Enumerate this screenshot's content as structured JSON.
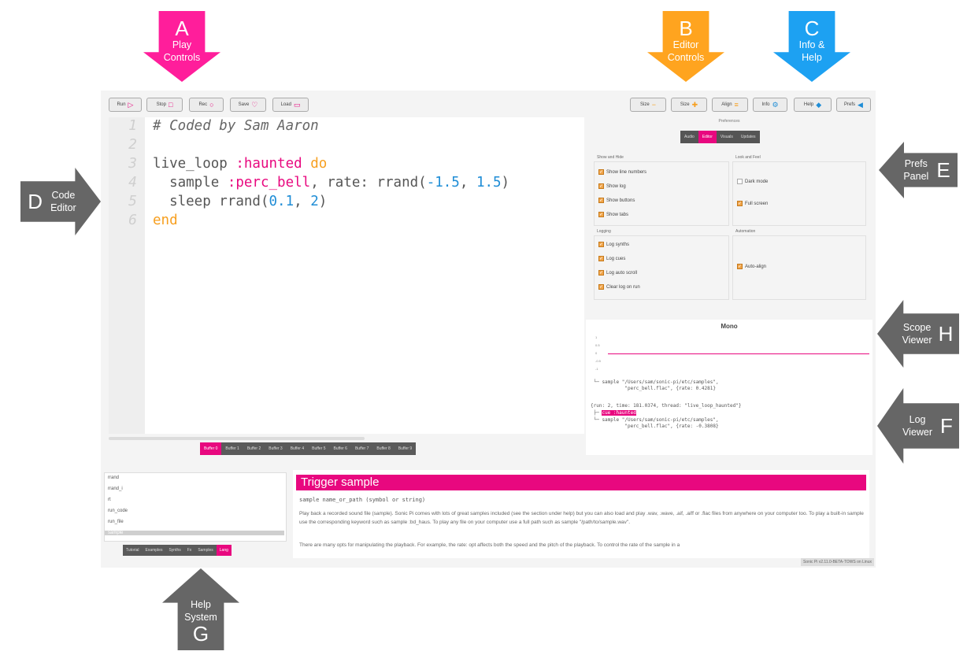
{
  "annotations": {
    "A": {
      "letter": "A",
      "caption": "Play\nControls",
      "color": "#ff1e9b"
    },
    "B": {
      "letter": "B",
      "caption": "Editor\nControls",
      "color": "#ffa41f"
    },
    "C": {
      "letter": "C",
      "caption": "Info &\nHelp",
      "color": "#1da1f2"
    },
    "D": {
      "letter": "D",
      "caption": "Code\nEditor",
      "color": "#666666"
    },
    "E": {
      "letter": "E",
      "caption": "Prefs\nPanel",
      "color": "#666666"
    },
    "F": {
      "letter": "F",
      "caption": "Log\nViewer",
      "color": "#666666"
    },
    "G": {
      "letter": "G",
      "caption": "Help\nSystem",
      "color": "#666666"
    },
    "H": {
      "letter": "H",
      "caption": "Scope\nViewer",
      "color": "#666666"
    }
  },
  "toolbar": {
    "run": "Run",
    "stop": "Stop",
    "rec": "Rec",
    "save": "Save",
    "load": "Load",
    "size_down": "Size",
    "size_up": "Size",
    "align": "Align",
    "info": "Info",
    "help": "Help",
    "prefs": "Prefs"
  },
  "editor": {
    "line_numbers": [
      "1",
      "2",
      "3",
      "4",
      "5",
      "6"
    ],
    "l1": "# Coded by Sam Aaron",
    "l3a": "live_loop ",
    "l3b": ":haunted",
    "l3c": " do",
    "l4a": "  sample ",
    "l4b": ":perc_bell",
    "l4c": ", rate: rrand(",
    "l4d": "-1.5",
    "l4e": ", ",
    "l4f": "1.5",
    "l4g": ")",
    "l5a": "  sleep rrand(",
    "l5b": "0.1",
    "l5c": ", ",
    "l5d": "2",
    "l5e": ")",
    "l6": "end"
  },
  "buffers": [
    "Buffer 0",
    "Buffer 1",
    "Buffer 2",
    "Buffer 3",
    "Buffer 4",
    "Buffer 5",
    "Buffer 6",
    "Buffer 7",
    "Buffer 8",
    "Buffer 9"
  ],
  "prefs": {
    "header": "Preferences",
    "tabs": [
      "Audio",
      "Editor",
      "Visuals",
      "Updates"
    ],
    "group_show_hide": "Show and Hide",
    "show_line_numbers": "Show line numbers",
    "show_log": "Show log",
    "show_buttons": "Show buttons",
    "show_tabs": "Show tabs",
    "group_look_feel": "Look and Feel",
    "dark_mode": "Dark mode",
    "full_screen": "Full screen",
    "group_logging": "Logging",
    "log_synths": "Log synths",
    "log_cues": "Log cues",
    "log_auto_scroll": "Log auto scroll",
    "clear_log": "Clear log on run",
    "group_automation": "Automation",
    "auto_align": "Auto-align"
  },
  "scope": {
    "title": "Mono",
    "ticks": [
      "1",
      "0.5",
      "0",
      "-0.5",
      "-1"
    ]
  },
  "log": {
    "l1": " └─ sample \"/Users/sam/sonic-pi/etc/samples\",",
    "l2": "            \"perc_bell.flac\", {rate: 0.4281}",
    "l3": "{run: 2, time: 181.0374, thread: \"live_loop_haunted\"}",
    "l4": " ├─ ",
    "l4hl": "cue :haunted",
    "l5": " └─ sample \"/Users/sam/sonic-pi/etc/samples\",",
    "l6": "            \"perc_bell.flac\", {rate: -0.3808}"
  },
  "help": {
    "items": [
      "rrand",
      "rrand_i",
      "rt",
      "run_code",
      "run_file",
      "sample"
    ],
    "tabs": [
      "Tutorial",
      "Examples",
      "Synths",
      "Fx",
      "Samples",
      "Lang"
    ],
    "doc_title": "Trigger sample",
    "doc_sig": "sample  name_or_path (symbol or string)",
    "doc_p1": "Play back a recorded sound file (sample). Sonic Pi comes with lots of great samples included (see the section under help) but you can also load and play .wav, .wave, .aif, .aiff or .flac files from anywhere on your computer too. To play a built-in sample use the corresponding keyword such as sample :bd_haus. To play any file on your computer use a full path such as sample \"/path/to/sample.wav\".",
    "doc_p2": "There are many opts for manipulating the playback. For example, the rate: opt affects both the speed and the pitch of the playback. To control the rate of the sample in a",
    "version": "Sonic Pi v2.11.0-BETA-TOWS on Linux"
  }
}
